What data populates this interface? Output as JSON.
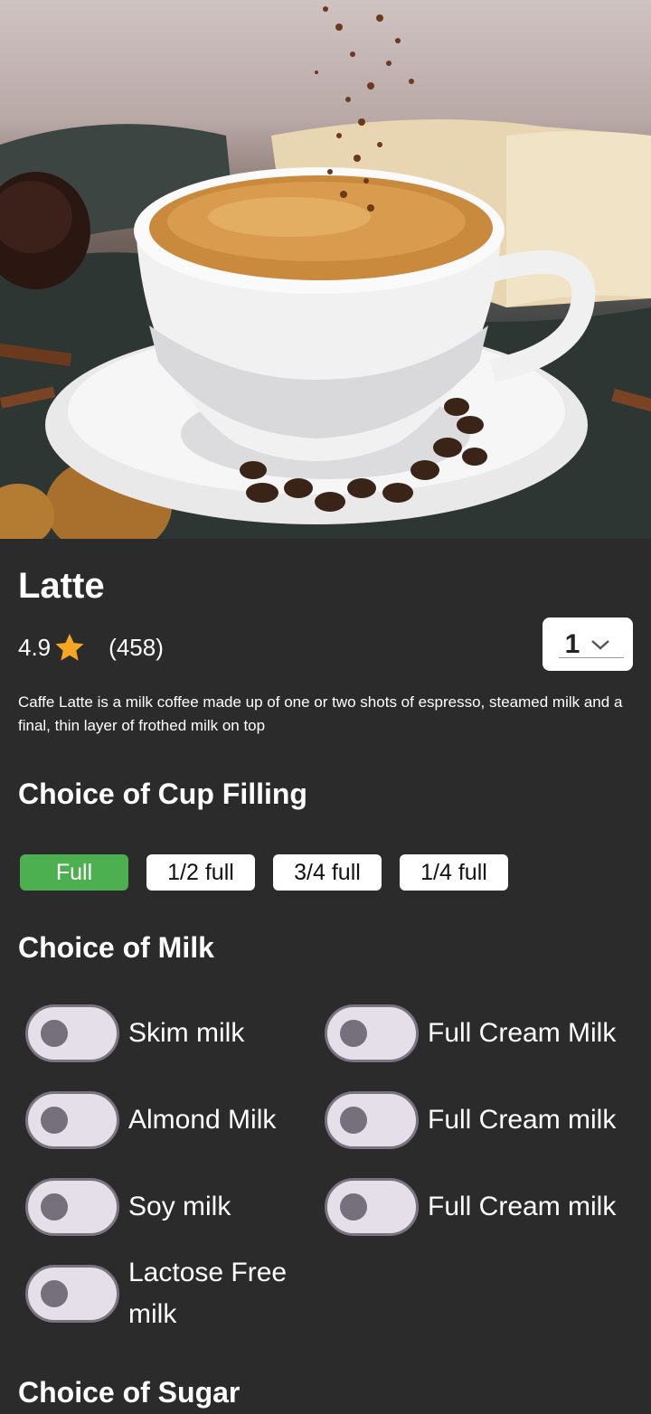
{
  "product": {
    "name": "Latte",
    "rating": "4.9",
    "review_count": "(458)",
    "quantity": "1",
    "description": "Caffe Latte is a milk coffee made up of one or two shots of espresso, steamed milk and a final, thin layer of frothed milk on top"
  },
  "cup_filling": {
    "title": "Choice of Cup Filling",
    "options": [
      "Full",
      "1/2 full",
      "3/4 full",
      "1/4 full"
    ],
    "selected": "Full"
  },
  "milk": {
    "title": "Choice of Milk",
    "options": [
      "Skim milk",
      "Full Cream Milk",
      "Almond Milk",
      "Full Cream milk",
      "Soy milk",
      "Full Cream milk",
      "Lactose Free milk"
    ],
    "states": [
      false,
      false,
      false,
      false,
      false,
      false,
      false
    ]
  },
  "sugar": {
    "title": "Choice of Sugar"
  },
  "colors": {
    "background": "#2b2b2b",
    "selected_chip": "#4caf50",
    "star": "#f5a623",
    "toggle_track": "#e4dfe8",
    "toggle_knob": "#76707c"
  },
  "icons": {
    "star": "star-icon",
    "dropdown": "chevron-down-icon"
  }
}
